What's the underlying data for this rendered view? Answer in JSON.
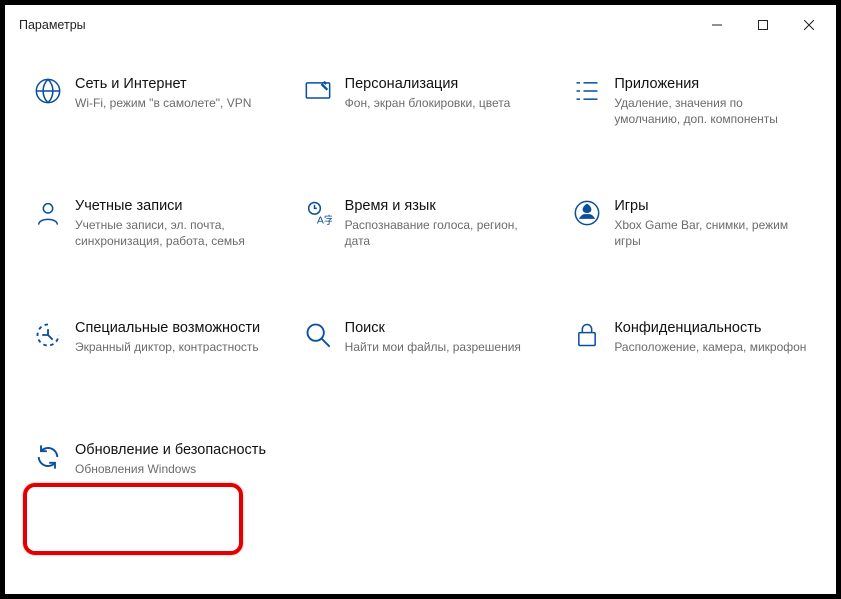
{
  "window": {
    "title": "Параметры"
  },
  "tiles": [
    {
      "label": "Сеть и Интернет",
      "desc": "Wi-Fi, режим \"в самолете\", VPN"
    },
    {
      "label": "Персонализация",
      "desc": "Фон, экран блокировки, цвета"
    },
    {
      "label": "Приложения",
      "desc": "Удаление, значения по умолчанию, доп. компоненты"
    },
    {
      "label": "Учетные записи",
      "desc": "Учетные записи, эл. почта, синхронизация, работа, семья"
    },
    {
      "label": "Время и язык",
      "desc": "Распознавание голоса, регион, дата"
    },
    {
      "label": "Игры",
      "desc": "Xbox Game Bar, снимки, режим игры"
    },
    {
      "label": "Специальные возможности",
      "desc": "Экранный диктор, контрастность"
    },
    {
      "label": "Поиск",
      "desc": "Найти мои файлы, разрешения"
    },
    {
      "label": "Конфиденциальность",
      "desc": "Расположение, камера, микрофон"
    },
    {
      "label": "Обновление и безопасность",
      "desc": "Обновления Windows"
    }
  ]
}
